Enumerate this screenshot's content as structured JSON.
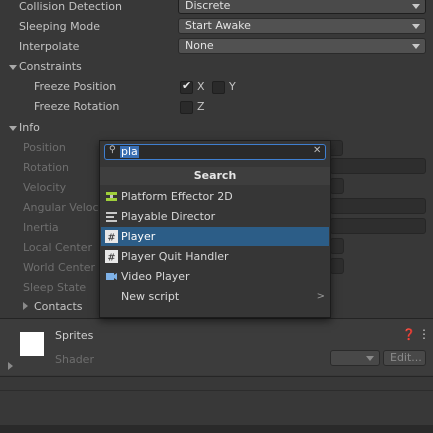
{
  "rigidbody": {
    "collision_detection_label": "Collision Detection",
    "collision_detection_value": "Discrete",
    "sleeping_mode_label": "Sleeping Mode",
    "sleeping_mode_value": "Start Awake",
    "interpolate_label": "Interpolate",
    "interpolate_value": "None",
    "constraints_label": "Constraints",
    "freeze_position_label": "Freeze Position",
    "freeze_position_x_label": "X",
    "freeze_position_x_checked": true,
    "freeze_position_y_label": "Y",
    "freeze_position_y_checked": false,
    "freeze_rotation_label": "Freeze Rotation",
    "freeze_rotation_z_label": "Z",
    "freeze_rotation_z_checked": false,
    "info_label": "Info",
    "info_fields": [
      "Position",
      "Rotation",
      "Velocity",
      "Angular Veloc",
      "Inertia",
      "Local Center",
      "World Center",
      "Sleep State"
    ],
    "contacts_label": "Contacts"
  },
  "material": {
    "name": "Sprites",
    "shader_label": "Shader",
    "edit_label": "Edit..."
  },
  "add_component_popup": {
    "search_value": "pla",
    "title": "Search",
    "items": [
      {
        "label": "Platform Effector 2D",
        "icon": "platform-effector-icon",
        "selected": false
      },
      {
        "label": "Playable Director",
        "icon": "playable-director-icon",
        "selected": false
      },
      {
        "label": "Player",
        "icon": "script-icon",
        "selected": true
      },
      {
        "label": "Player Quit Handler",
        "icon": "script-icon",
        "selected": false
      },
      {
        "label": "Video Player",
        "icon": "video-player-icon",
        "selected": false
      },
      {
        "label": "New script",
        "icon": "",
        "selected": false,
        "submenu": true
      }
    ]
  },
  "colors": {
    "background": "#383838",
    "selection": "#2c5d87",
    "search_focus": "#3f7fd0"
  }
}
